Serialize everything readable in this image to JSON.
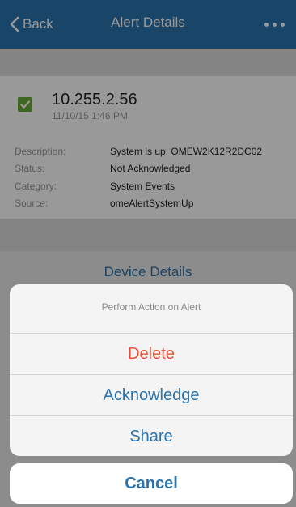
{
  "nav": {
    "back_label": "Back",
    "title": "Alert Details",
    "more_icon": "ellipsis-icon"
  },
  "alert": {
    "ip": "10.255.2.56",
    "timestamp": "11/10/15 1:46 PM",
    "status_icon": "checkbox-checked-icon",
    "fields": [
      {
        "label": "Description:",
        "value": "System is up: OMEW2K12R2DC02"
      },
      {
        "label": "Status:",
        "value": "Not Acknowledged"
      },
      {
        "label": "Category:",
        "value": "System Events"
      },
      {
        "label": "Source:",
        "value": "omeAlertSystemUp"
      }
    ]
  },
  "device_details_link": "Device Details",
  "action_sheet": {
    "title": "Perform Action on Alert",
    "actions": [
      {
        "label": "Delete",
        "color": "#e5533d"
      },
      {
        "label": "Acknowledge",
        "color": "#2a73ad"
      },
      {
        "label": "Share",
        "color": "#2a73ad"
      }
    ],
    "cancel_label": "Cancel",
    "cancel_color": "#2a73ad"
  },
  "colors": {
    "nav_blue": "#2a73ad",
    "check_green": "#6aa93b"
  }
}
